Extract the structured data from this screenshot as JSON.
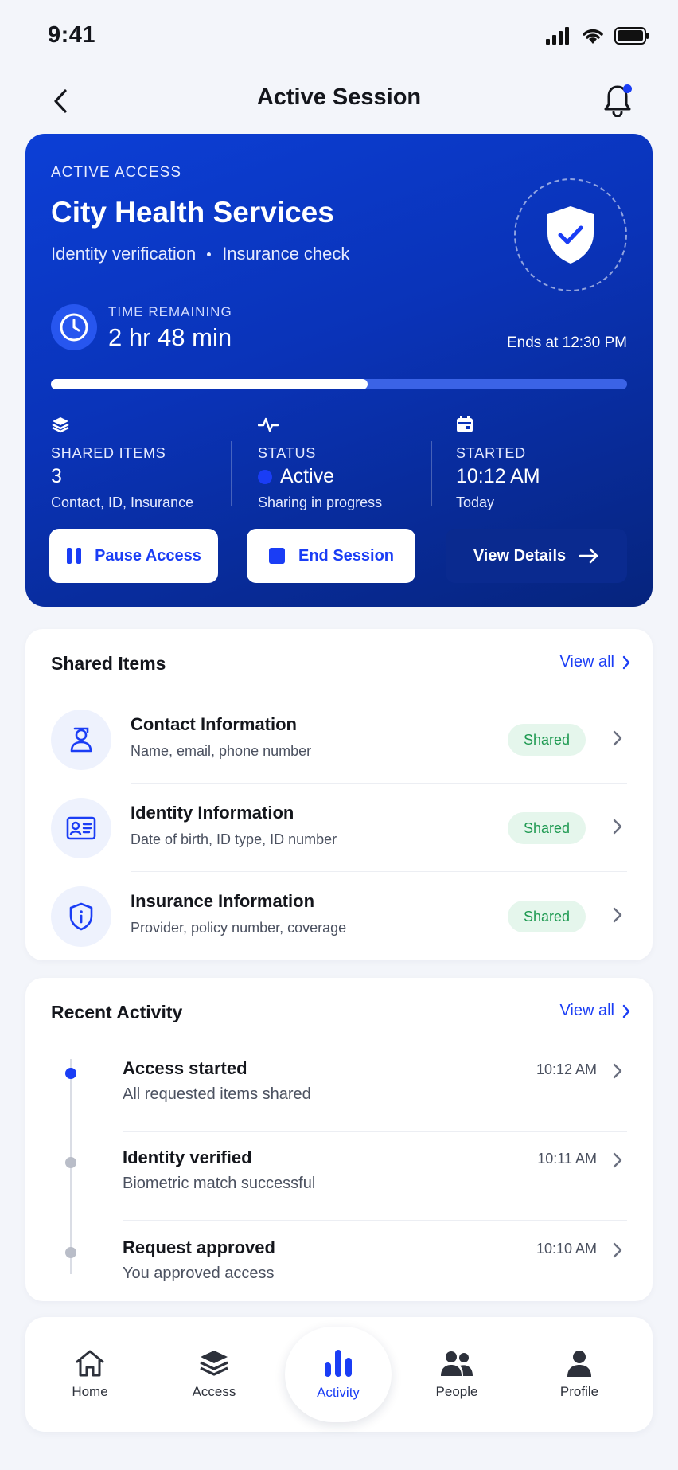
{
  "status_bar": {
    "time": "9:41"
  },
  "header": {
    "title": "Active Session"
  },
  "hero": {
    "kicker": "ACTIVE ACCESS",
    "title": "City Health Services",
    "purposes": [
      "Identity verification",
      "Insurance check"
    ],
    "time_label": "TIME REMAINING",
    "time_value": "2 hr 48 min",
    "ends_at": "Ends at 12:30 PM",
    "progress_fraction": 0.55,
    "stats": [
      {
        "label": "SHARED ITEMS",
        "value": "3",
        "sub": "Contact, ID, Insurance"
      },
      {
        "label": "STATUS",
        "value": "Active",
        "sub": "Sharing in progress"
      },
      {
        "label": "STARTED",
        "value": "10:12 AM",
        "sub": "Today"
      }
    ],
    "buttons": {
      "pause": "Pause Access",
      "end": "End Session",
      "details": "View Details"
    }
  },
  "shared_items": {
    "title": "Shared Items",
    "view_all": "View all",
    "items": [
      {
        "title": "Contact Information",
        "sub": "Name, email, phone number",
        "badge": "Shared"
      },
      {
        "title": "Identity Information",
        "sub": "Date of birth, ID type, ID number",
        "badge": "Shared"
      },
      {
        "title": "Insurance Information",
        "sub": "Provider, policy number, coverage",
        "badge": "Shared"
      }
    ]
  },
  "recent_activity": {
    "title": "Recent Activity",
    "view_all": "View all",
    "items": [
      {
        "title": "Access started",
        "sub": "All requested items shared",
        "time": "10:12 AM"
      },
      {
        "title": "Identity verified",
        "sub": "Biometric match successful",
        "time": "10:11 AM"
      },
      {
        "title": "Request approved",
        "sub": "You approved access",
        "time": "10:10 AM"
      }
    ]
  },
  "tabbar": {
    "tabs": [
      {
        "label": "Home",
        "icon": "home-icon"
      },
      {
        "label": "Access",
        "icon": "layers-icon"
      },
      {
        "label": "Activity",
        "icon": "bar-chart-icon"
      },
      {
        "label": "People",
        "icon": "people-icon"
      },
      {
        "label": "Profile",
        "icon": "person-icon"
      }
    ],
    "active": "Activity"
  },
  "colors": {
    "accent": "#1a3df5",
    "hero_dark": "#06247d",
    "success": "#1f9a52"
  }
}
